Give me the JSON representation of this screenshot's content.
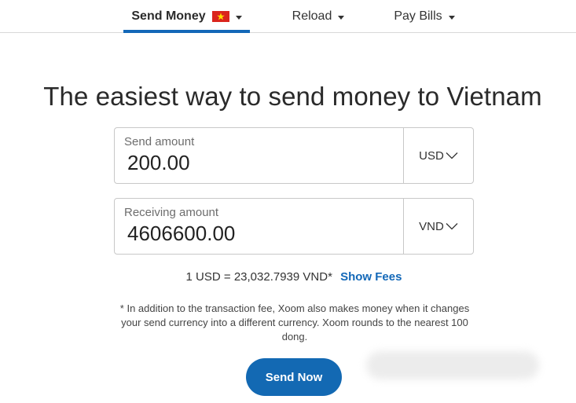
{
  "nav": {
    "items": [
      {
        "label": "Send Money",
        "active": true,
        "flag": "vietnam-flag-icon"
      },
      {
        "label": "Reload",
        "active": false
      },
      {
        "label": "Pay Bills",
        "active": false
      }
    ]
  },
  "headline": "The easiest way to send money to Vietnam",
  "send": {
    "label": "Send amount",
    "value": "200.00",
    "currency": "USD"
  },
  "receive": {
    "label": "Receiving amount",
    "value": "4606600.00",
    "currency": "VND"
  },
  "rate": {
    "text": "1 USD = 23,032.7939 VND*",
    "link": "Show Fees"
  },
  "disclaimer": "* In addition to the transaction fee, Xoom also makes money when it changes your send currency into a different currency. Xoom rounds to the nearest 100 dong.",
  "button": {
    "label": "Send Now"
  },
  "colors": {
    "accent": "#1368b8",
    "button": "#1369b3",
    "flag_red": "#da251d",
    "flag_star": "#ffde00"
  }
}
